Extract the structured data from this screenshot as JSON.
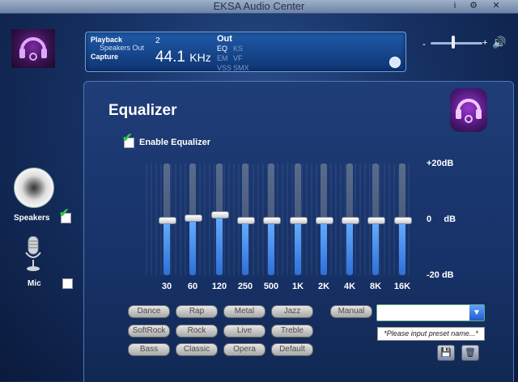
{
  "window": {
    "title": "EKSA Audio Center"
  },
  "titlebar": {
    "info_icon": "i",
    "settings_icon": "⚙",
    "close_icon": "✕"
  },
  "status": {
    "playback_label": "Playback",
    "device_label": "Speakers Out",
    "capture_label": "Capture",
    "channel": "2",
    "freq_value": "44.1",
    "freq_unit": "KHz",
    "out_label": "Out",
    "fx": {
      "eq": "EQ",
      "ks": "KS",
      "em": "EM",
      "vf": "VF",
      "vss": "VSS",
      "smx": "SMX"
    }
  },
  "volume": {
    "minus": "-",
    "plus": "+",
    "level": 0.45
  },
  "devices": {
    "speakers_label": "Speakers",
    "speakers_checked": true,
    "mic_label": "Mic",
    "mic_checked": false
  },
  "equalizer": {
    "title": "Equalizer",
    "enable_label": "Enable Equalizer",
    "enabled": true,
    "db_top": "+20dB",
    "db_mid": "0     dB",
    "db_bottom": "-20 dB",
    "bands": [
      {
        "freq": "30",
        "gain_db": 0
      },
      {
        "freq": "60",
        "gain_db": 1
      },
      {
        "freq": "120",
        "gain_db": 2
      },
      {
        "freq": "250",
        "gain_db": 0
      },
      {
        "freq": "500",
        "gain_db": 0
      },
      {
        "freq": "1K",
        "gain_db": 0
      },
      {
        "freq": "2K",
        "gain_db": 0
      },
      {
        "freq": "4K",
        "gain_db": 0
      },
      {
        "freq": "8K",
        "gain_db": 0
      },
      {
        "freq": "16K",
        "gain_db": 0
      }
    ]
  },
  "presets": {
    "row1": [
      "Dance",
      "Rap",
      "Metal",
      "Jazz"
    ],
    "row2": [
      "SoftRock",
      "Rock",
      "Live",
      "Treble"
    ],
    "row3": [
      "Bass",
      "Classic",
      "Opera",
      "Default"
    ],
    "manual_label": "Manual",
    "select_value": "",
    "name_placeholder": "*Please input preset name...*"
  }
}
